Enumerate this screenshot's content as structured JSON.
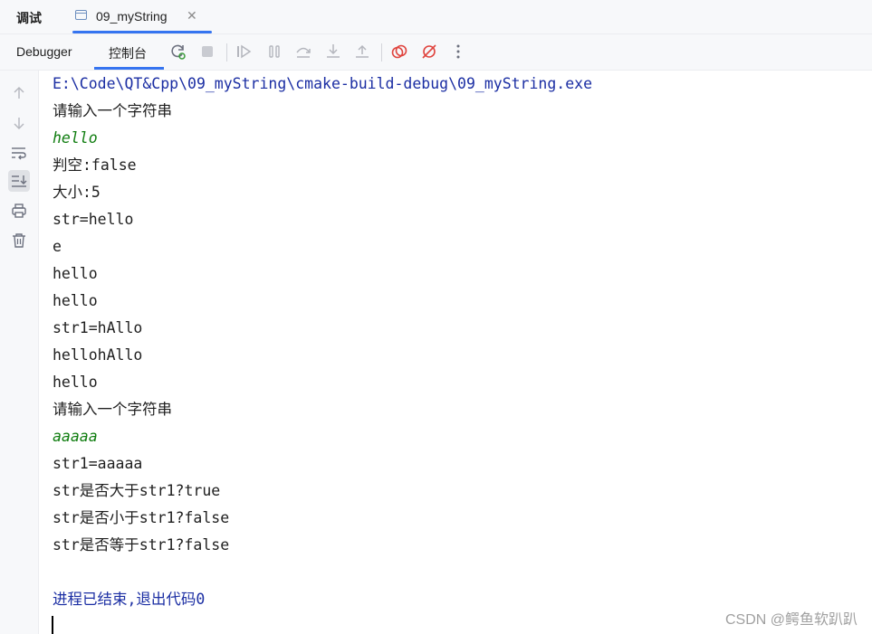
{
  "tool_window": {
    "title": "调试"
  },
  "session_tab": {
    "label": "09_myString",
    "close": "✕"
  },
  "toolbar": {
    "tabs": [
      "Debugger",
      "控制台"
    ],
    "icons": [
      "rerun-icon",
      "stop-icon",
      "resume-icon",
      "pause-icon",
      "step-over-icon",
      "step-into-icon",
      "step-out-icon",
      "breakpoints-icon",
      "mute-breakpoints-icon",
      "more-icon"
    ]
  },
  "gutter": {
    "icons": [
      "arrow-up-icon",
      "arrow-down-icon",
      "soft-wrap-icon",
      "scroll-to-end-icon",
      "print-icon",
      "trash-icon"
    ]
  },
  "console": {
    "lines": [
      {
        "text": "E:\\Code\\QT&Cpp\\09_myString\\cmake-build-debug\\09_myString.exe",
        "kind": "path"
      },
      {
        "text": "请输入一个字符串",
        "kind": "output"
      },
      {
        "text": "hello",
        "kind": "input"
      },
      {
        "text": "判空:false",
        "kind": "output"
      },
      {
        "text": "大小:5",
        "kind": "output"
      },
      {
        "text": "str=hello",
        "kind": "output"
      },
      {
        "text": "e",
        "kind": "output"
      },
      {
        "text": "hello",
        "kind": "output"
      },
      {
        "text": "hello",
        "kind": "output"
      },
      {
        "text": "str1=hAllo",
        "kind": "output"
      },
      {
        "text": "hellohAllo",
        "kind": "output"
      },
      {
        "text": "hello",
        "kind": "output"
      },
      {
        "text": "请输入一个字符串",
        "kind": "output"
      },
      {
        "text": "aaaaa",
        "kind": "input"
      },
      {
        "text": "str1=aaaaa",
        "kind": "output"
      },
      {
        "text": "str是否大于str1?true",
        "kind": "output"
      },
      {
        "text": "str是否小于str1?false",
        "kind": "output"
      },
      {
        "text": "str是否等于str1?false",
        "kind": "output"
      },
      {
        "text": "",
        "kind": "output"
      },
      {
        "text": "进程已结束,退出代码0",
        "kind": "exit"
      }
    ]
  },
  "watermark": "CSDN @鳄鱼软趴趴",
  "colors": {
    "accent": "#3574f0",
    "path_text": "#1b2ea3",
    "input_text": "#107d10",
    "rerun_green": "#3a9b3a",
    "breakpoint_red": "#e0443e"
  }
}
